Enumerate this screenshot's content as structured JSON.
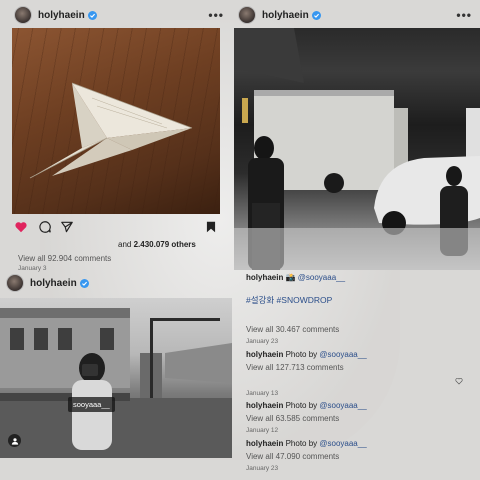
{
  "posts": {
    "p1": {
      "username": "holyhaein",
      "more": "•••",
      "likes_prefix": "and",
      "likes_count": "2.430.079",
      "likes_suffix": "others",
      "view_all": "View all 92.904 comments",
      "date": "January 3"
    },
    "p2": {
      "username": "holyhaein",
      "more": "•••",
      "caption_user": "holyhaein",
      "caption_emoji": "📸",
      "caption_mention": "@sooyaaa__",
      "hashtags": "#설강화 #SNOWDROP",
      "view_all_1": "View all 30.467 comments",
      "date_1": "January 23",
      "caption2_user": "holyhaein",
      "caption2_text": "Photo by",
      "caption2_mention": "@sooyaaa__",
      "view_all_2": "View all 127.713 comments",
      "date_2": "January 13",
      "caption3_user": "holyhaein",
      "caption3_text": "Photo by",
      "caption3_mention": "@sooyaaa__",
      "view_all_3": "View all 63.585 comments",
      "date_3": "January 12",
      "caption4_user": "holyhaein",
      "caption4_text": "Photo by",
      "caption4_mention": "@sooyaaa__",
      "view_all_4": "View all 47.090 comments",
      "date_4": "January 23"
    },
    "p3": {
      "username": "holyhaein",
      "tag_label": "sooyaaa__"
    }
  },
  "icons": {
    "heart_color": "#e0245e",
    "verified_color": "#3897f0"
  }
}
